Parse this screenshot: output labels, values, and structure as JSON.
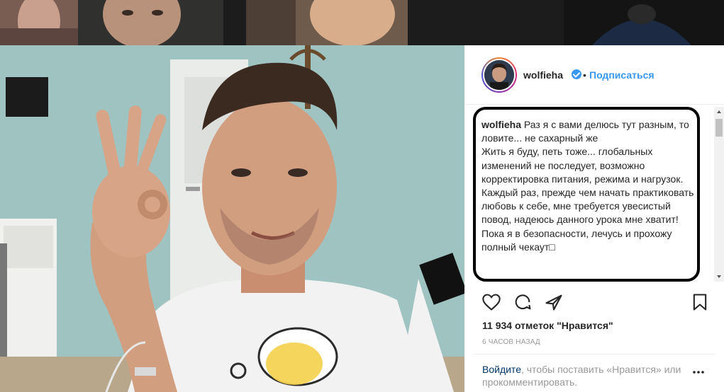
{
  "post": {
    "username": "wolfieha",
    "separator": "•",
    "follow_label": "Подписаться",
    "caption_username": "wolfieha",
    "caption_lines": [
      "Раз я с вами делюсь тут разным, то ловите... не сахарный же",
      "Жить я буду, петь тоже... глобальных изменений не последует, возможно корректировка питания, режима и нагрузок.",
      "Каждый раз, прежде чем начать практиковать любовь к себе, мне требуется увесистый повод, надеюсь данного урока мне хватит!",
      "Пока я в безопасности, лечусь и прохожу полный чекаут□"
    ],
    "likes_text": "11 934 отметок \"Нравится\"",
    "time_text": "6 часов назад",
    "login_link": "Войдите",
    "login_rest": ", чтобы поставить «Нравится» или прокомментировать."
  },
  "icons": {
    "like": "heart-icon",
    "comment": "comment-icon",
    "share": "share-icon",
    "save": "bookmark-icon",
    "verified": "verified-badge-icon",
    "more": "more-options-icon"
  },
  "colors": {
    "link": "#3897f0",
    "login_link": "#003569",
    "wall": "#9fc3c0",
    "highlight_border": "#000000"
  }
}
